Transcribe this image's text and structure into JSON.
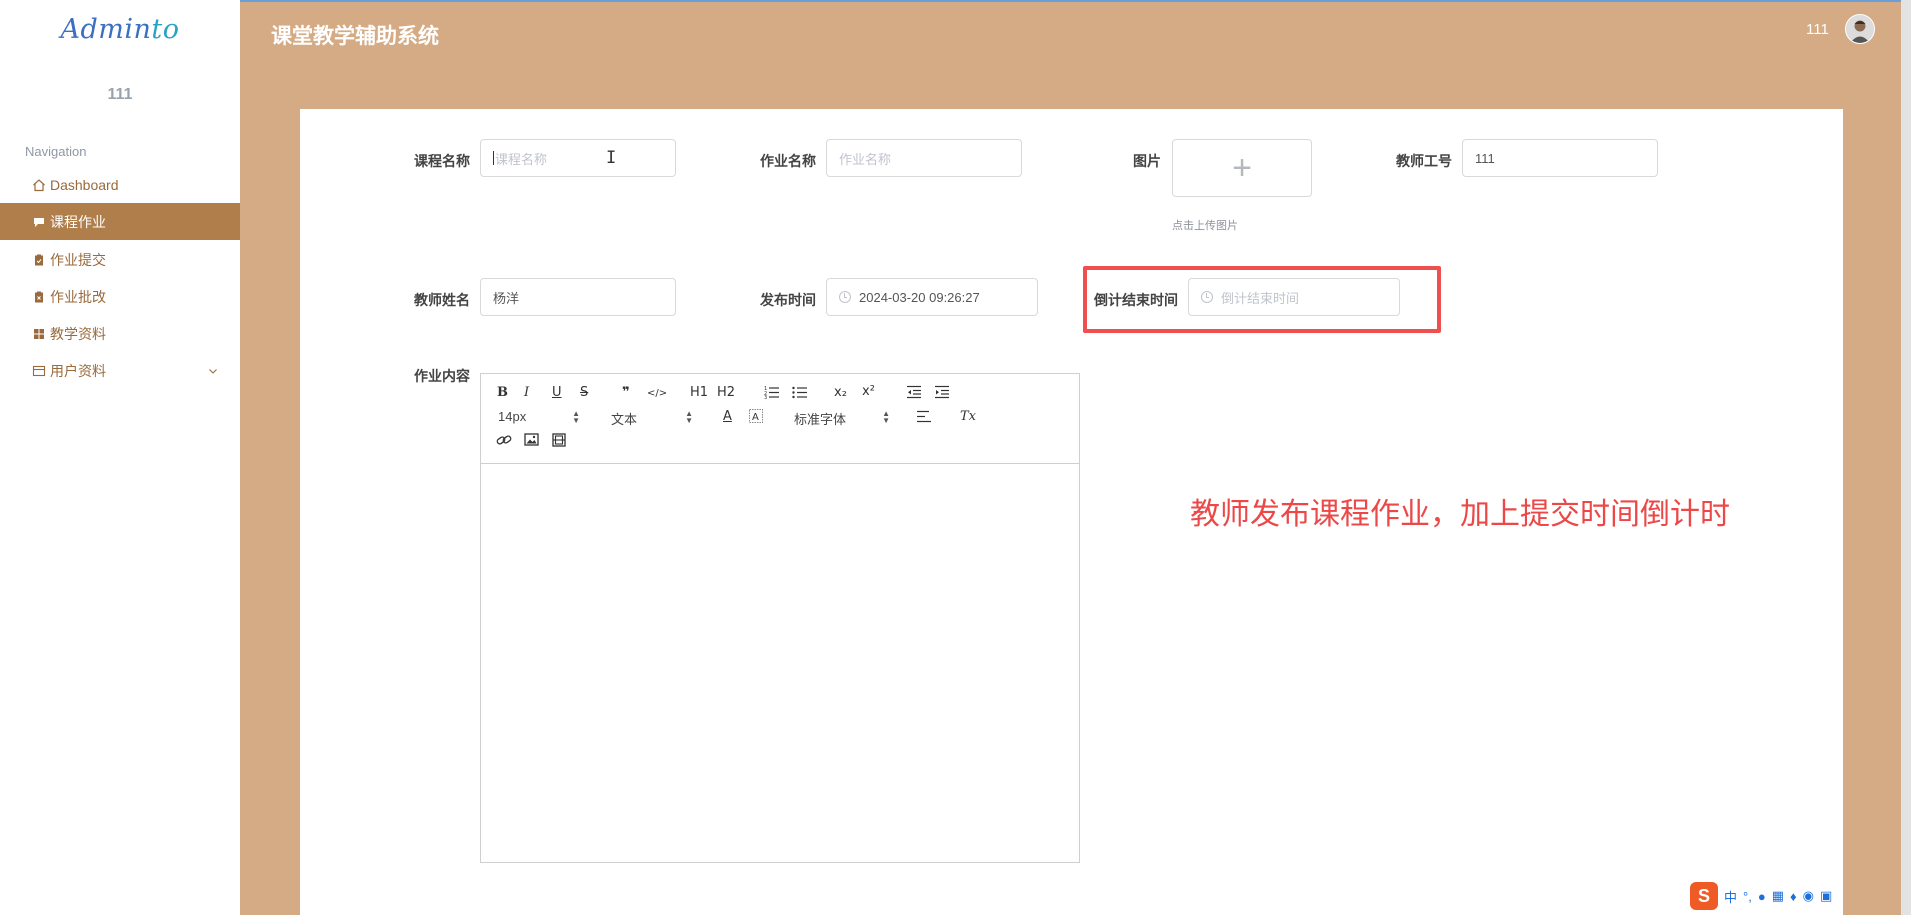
{
  "sidebar": {
    "logo_main": "Admin",
    "logo_accent": "to",
    "username": "111",
    "nav_heading": "Navigation",
    "items": [
      {
        "label": "Dashboard",
        "icon": "home-icon"
      },
      {
        "label": "课程作业",
        "icon": "chat-icon",
        "active": true
      },
      {
        "label": "作业提交",
        "icon": "clipboard-icon"
      },
      {
        "label": "作业批改",
        "icon": "clipboard-check-icon"
      },
      {
        "label": "教学资料",
        "icon": "grid-icon"
      },
      {
        "label": "用户资料",
        "icon": "card-icon",
        "expandable": true
      }
    ]
  },
  "header": {
    "title": "课堂教学辅助系统",
    "user": "111"
  },
  "form": {
    "course_name": {
      "label": "课程名称",
      "placeholder": "课程名称",
      "value": ""
    },
    "homework_name": {
      "label": "作业名称",
      "placeholder": "作业名称",
      "value": ""
    },
    "image": {
      "label": "图片",
      "upload_symbol": "+",
      "hint": "点击上传图片"
    },
    "teacher_id": {
      "label": "教师工号",
      "value": "111"
    },
    "teacher_name": {
      "label": "教师姓名",
      "value": "杨洋"
    },
    "publish_time": {
      "label": "发布时间",
      "value": "2024-03-20 09:26:27"
    },
    "countdown_end": {
      "label": "倒计结束时间",
      "placeholder": "倒计结束时间",
      "value": ""
    },
    "content": {
      "label": "作业内容"
    }
  },
  "editor_toolbar": {
    "font_size": "14px",
    "header_select": "文本",
    "font_family": "标准字体",
    "buttons": {
      "bold": "B",
      "italic": "I",
      "underline": "U",
      "strike": "S",
      "quote": "❞",
      "code": "</>",
      "h1": "H1",
      "h2": "H2",
      "sub": "x₂",
      "sup": "x²",
      "clean": "Tx",
      "color": "A"
    }
  },
  "annotation": "教师发布课程作业，加上提交时间倒计时",
  "colors": {
    "background": "#d4ab85",
    "sidebar_active": "#b07e4b",
    "highlight": "#ef4f4f"
  }
}
